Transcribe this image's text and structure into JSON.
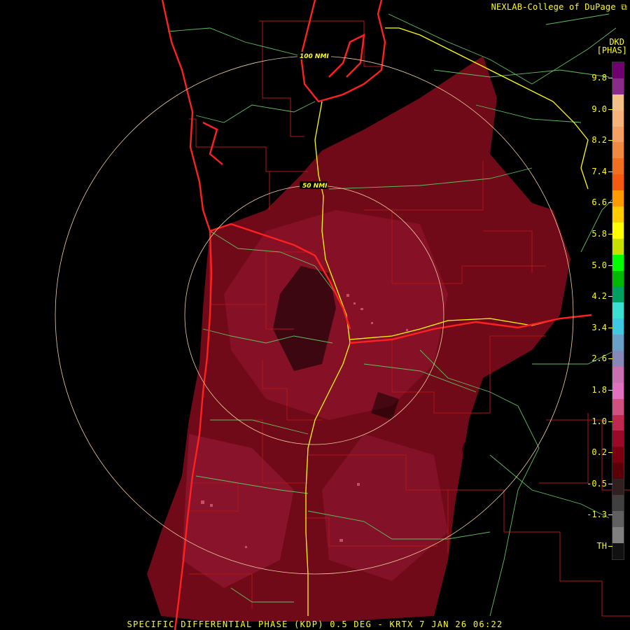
{
  "credit": "NEXLAB-College of DuPage",
  "credit_icon": "external-link-icon",
  "product": {
    "units_code": "DKD",
    "units_label": "[PHAS]",
    "caption": "SPECIFIC DIFFERENTIAL PHASE (KDP) 0.5 DEG - KRTX 7 JAN 26 06:22"
  },
  "range_rings": [
    {
      "label": "50 NMI"
    },
    {
      "label": "100 NMI"
    }
  ],
  "colorbar": {
    "ticks": [
      "9.8",
      "9.0",
      "8.2",
      "7.4",
      "6.6",
      "5.8",
      "5.0",
      "4.2",
      "3.4",
      "2.6",
      "1.8",
      "1.0",
      "0.2",
      "-0.5",
      "-1.3",
      "TH"
    ],
    "colors": [
      "#700070",
      "#8a2a8a",
      "#f3c08a",
      "#f5b27a",
      "#f3a062",
      "#f08a40",
      "#f07020",
      "#f55a10",
      "#ff9a00",
      "#ffcc00",
      "#ffff00",
      "#c8e000",
      "#00ff00",
      "#00b800",
      "#00a060",
      "#3ae0d0",
      "#40c8e0",
      "#6aa0c8",
      "#8888b8",
      "#c870b0",
      "#e070c0",
      "#d05080",
      "#c02850",
      "#9a0a28",
      "#7a0010",
      "#5a0008",
      "#302020",
      "#404040",
      "#606060",
      "#808080",
      "#111111"
    ]
  },
  "colors": {
    "coast": "#ff2020",
    "county": "#b01818",
    "highway": "#60c060",
    "interstate": "#ffff00",
    "ring": "#f0d0a0",
    "echo": "#7a0a1a"
  }
}
